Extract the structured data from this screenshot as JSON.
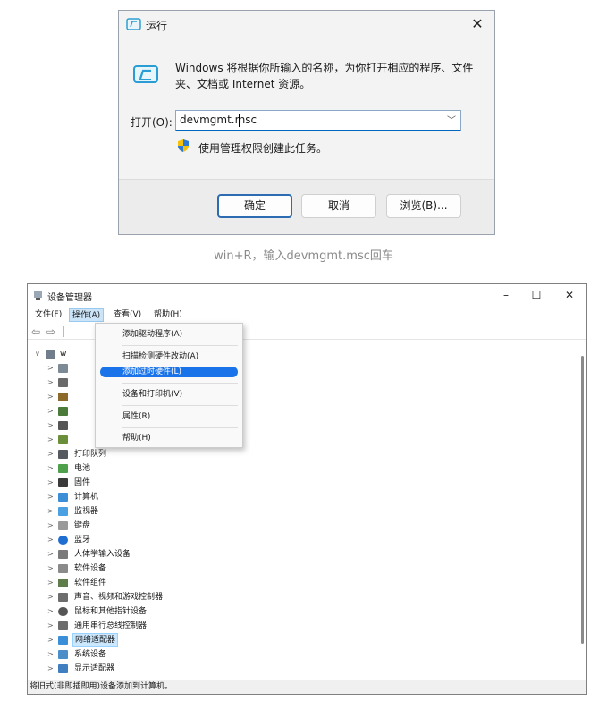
{
  "run_dialog": {
    "title": "运行",
    "description": "Windows 将根据你所输入的名称，为你打开相应的程序、文件夹、文档或 Internet 资源。",
    "open_label": "打开(O):",
    "input_value": "devmgmt.msc",
    "admin_note": "使用管理权限创建此任务。",
    "ok_label": "确定",
    "cancel_label": "取消",
    "browse_label": "浏览(B)...",
    "icons": [
      "run-app-icon",
      "close-icon",
      "chevron-down-icon",
      "shield-icon"
    ]
  },
  "caption": "win+R，输入devmgmt.msc回车",
  "device_manager": {
    "title": "设备管理器",
    "window_controls": {
      "minimize": "–",
      "maximize": "☐",
      "close": "✕"
    },
    "menu": [
      {
        "label": "文件(F)"
      },
      {
        "label": "操作(A)"
      },
      {
        "label": "查看(V)"
      },
      {
        "label": "帮助(H)"
      }
    ],
    "action_menu": [
      {
        "label": "添加驱动程序(A)"
      },
      {
        "label": "扫描检测硬件改动(A)"
      },
      {
        "label": "添加过时硬件(L)"
      },
      {
        "label": "设备和打印机(V)"
      },
      {
        "label": "属性(R)"
      },
      {
        "label": "帮助(H)"
      }
    ],
    "root_label": "w",
    "tree_items": [
      {
        "label": "打印队列"
      },
      {
        "label": "电池"
      },
      {
        "label": "固件"
      },
      {
        "label": "计算机"
      },
      {
        "label": "监视器"
      },
      {
        "label": "键盘"
      },
      {
        "label": "蓝牙"
      },
      {
        "label": "人体学输入设备"
      },
      {
        "label": "软件设备"
      },
      {
        "label": "软件组件"
      },
      {
        "label": "声音、视频和游戏控制器"
      },
      {
        "label": "鼠标和其他指针设备"
      },
      {
        "label": "通用串行总线控制器"
      },
      {
        "label": "网络适配器"
      },
      {
        "label": "系统设备"
      },
      {
        "label": "显示适配器"
      }
    ],
    "status": "将旧式(非即插即用)设备添加到计算机。",
    "colors": {
      "selection": "#cce8ff",
      "menu_highlight": "#1a73e8",
      "accent": "#0067c0"
    }
  }
}
